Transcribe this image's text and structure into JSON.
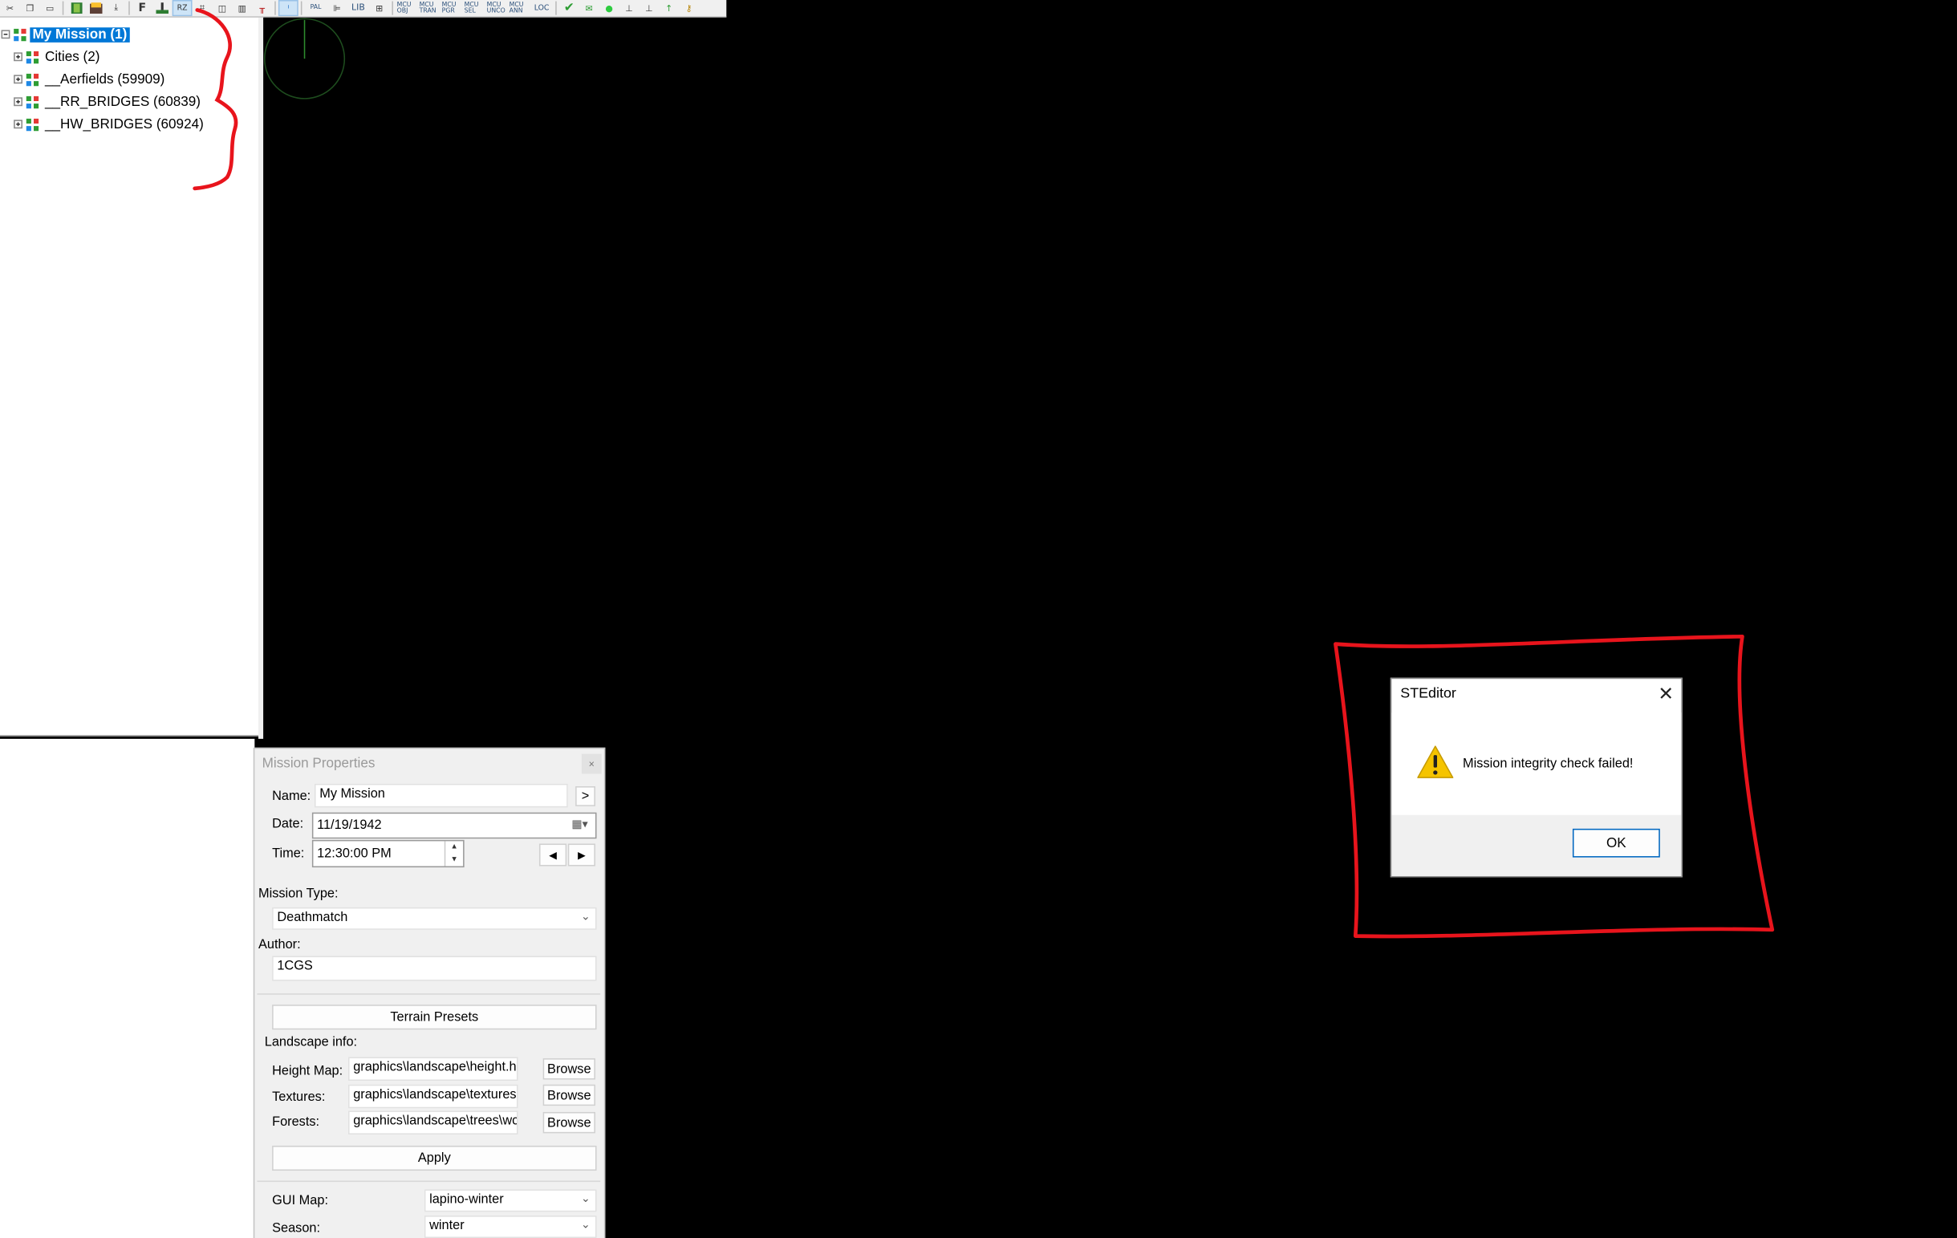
{
  "toolbar": {
    "icons": [
      "scissors-icon",
      "copy-icon",
      "ruler-icon",
      "book-icon",
      "book-stack-icon",
      "download-icon",
      "f-icon",
      "ground-icon",
      "rz-icon",
      "grid-icon",
      "window-icon",
      "building-icon",
      "tower-icon",
      "info-icon",
      "pal-icon",
      "tree-view-icon",
      "lib-icon",
      "layer-icon",
      "mcu-obj-icon",
      "mcu-tran-icon",
      "mcu-pgr-icon",
      "mcu-sel-icon",
      "mcu-unco-icon",
      "mcu-ann-icon",
      "loc-icon",
      "check-icon",
      "mail-icon",
      "dot-icon",
      "measure-icon",
      "align-icon",
      "arrow-up-icon",
      "key-icon"
    ],
    "labels": {
      "pal": "PAL",
      "lib": "LIB",
      "mcu_obj": "MCU OBJ",
      "mcu_tran": "MCU TRAN",
      "mcu_pgr": "MCU PGR",
      "mcu_sel": "MCU SEL",
      "mcu_unco": "MCU UNCO",
      "mcu_ann": "MCU ANN",
      "loc": "LOC"
    }
  },
  "tree": {
    "root": "My Mission (1)",
    "children": [
      "Cities (2)",
      "__Aerfields (59909)",
      "__RR_BRIDGES (60839)",
      "__HW_BRIDGES (60924)"
    ]
  },
  "properties": {
    "title": "Mission Properties",
    "close": "×",
    "name_label": "Name:",
    "name_value": "My Mission",
    "name_button": ">",
    "date_label": "Date:",
    "date_value": "11/19/1942",
    "time_label": "Time:",
    "time_value": "12:30:00 PM",
    "mission_type_label": "Mission Type:",
    "mission_type_value": "Deathmatch",
    "author_label": "Author:",
    "author_value": "1CGS",
    "terrain_presets": "Terrain Presets",
    "landscape_label": "Landscape info:",
    "height_map_label": "Height Map:",
    "height_map_value": "graphics\\landscape\\height.hi",
    "textures_label": "Textures:",
    "textures_value": "graphics\\landscape\\textures.",
    "forests_label": "Forests:",
    "forests_value": "graphics\\landscape\\trees\\wc",
    "browse": "Browse",
    "apply": "Apply",
    "gui_map_label": "GUI Map:",
    "gui_map_value": "lapino-winter",
    "season_label": "Season:",
    "season_value": "winter"
  },
  "dialog": {
    "title": "STEditor",
    "close": "✕",
    "message": "Mission integrity check failed!",
    "ok": "OK"
  },
  "colors": {
    "selection": "#0078d7",
    "annotation": "#e8141c",
    "warning": "#f5c400"
  }
}
